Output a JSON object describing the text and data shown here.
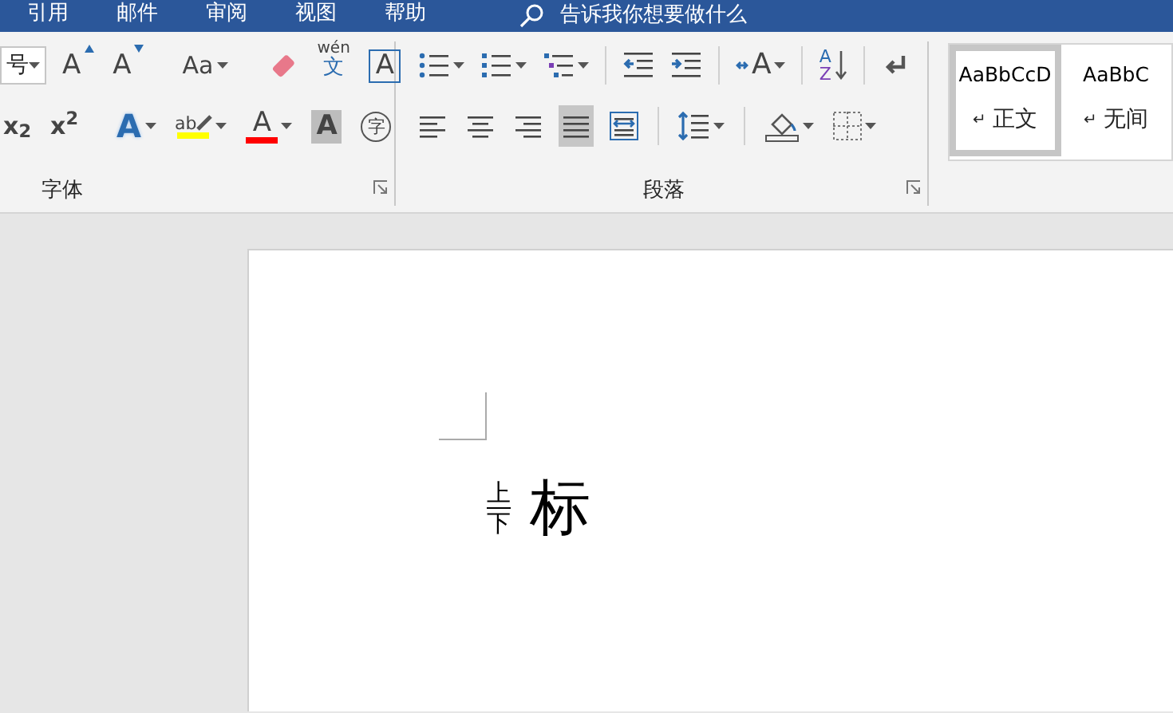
{
  "tabs": [
    {
      "label": "引用",
      "selected": false
    },
    {
      "label": "邮件",
      "selected": false
    },
    {
      "label": "审阅",
      "selected": false
    },
    {
      "label": "视图",
      "selected": false
    },
    {
      "label": "帮助",
      "selected": false
    }
  ],
  "search": {
    "text": "告诉我你想要做什么"
  },
  "font_group": {
    "label": "字体",
    "font_size": "号",
    "row_1": [
      {
        "kind": "grow",
        "glyph": "A"
      },
      {
        "kind": "shrink",
        "glyph": "A"
      },
      {
        "kind": "separator"
      },
      {
        "kind": "case",
        "glyph": "Aa",
        "dropdown": true
      },
      {
        "kind": "separator"
      },
      {
        "kind": "clear"
      },
      {
        "kind": "phonetic",
        "glyph": "wén",
        "glyph_2": "文"
      },
      {
        "kind": "char-border",
        "glyph": "A"
      }
    ],
    "row_2": [
      {
        "kind": "subscript",
        "glyph": "x$_{2}$"
      },
      {
        "kind": "superscript",
        "glyph": "x$^{2}$"
      },
      {
        "kind": "separator"
      },
      {
        "kind": "effects",
        "glyph": "A",
        "dropdown": true
      },
      {
        "kind": "highlight",
        "glyph": "ab",
        "dropdown": true,
        "color": "#ffff00"
      },
      {
        "kind": "font-color",
        "glyph": "A",
        "dropdown": true,
        "color": "#ff0000"
      },
      {
        "kind": "shading",
        "glyph": "A"
      },
      {
        "kind": "enclose",
        "glyph": "字"
      }
    ]
  },
  "paragraph_group": {
    "label": "段落",
    "row_1": [
      {
        "kind": "bullets",
        "dropdown": true
      },
      {
        "kind": "numbering",
        "dropdown": true
      },
      {
        "kind": "multilevel",
        "dropdown": true
      },
      {
        "kind": "separator"
      },
      {
        "kind": "indent-decrease"
      },
      {
        "kind": "indent-increase"
      },
      {
        "kind": "separator"
      },
      {
        "kind": "asian-layout",
        "glyph": "A",
        "dropdown": true
      },
      {
        "kind": "separator"
      },
      {
        "kind": "sort",
        "glyph": "A",
        "glyph_2": "Z"
      },
      {
        "kind": "separator"
      },
      {
        "kind": "marks"
      }
    ],
    "row_2": [
      {
        "kind": "align-left",
        "selected": false
      },
      {
        "kind": "align-center",
        "selected": false
      },
      {
        "kind": "align-right",
        "selected": false
      },
      {
        "kind": "justify",
        "selected": true
      },
      {
        "kind": "distribute",
        "selected": false
      },
      {
        "kind": "separator"
      },
      {
        "kind": "line-spacing",
        "dropdown": true
      },
      {
        "kind": "separator"
      },
      {
        "kind": "fill",
        "dropdown": true
      },
      {
        "kind": "borders",
        "dropdown": true
      }
    ]
  },
  "styles": [
    {
      "preview": "AaBbCcD",
      "mark": "↵",
      "name": "正文",
      "selected": true
    },
    {
      "preview": "AaBbC",
      "mark": "↵",
      "name": "无间",
      "selected": false
    }
  ],
  "document": {
    "upper": "上",
    "lower": "下",
    "text": "标"
  }
}
